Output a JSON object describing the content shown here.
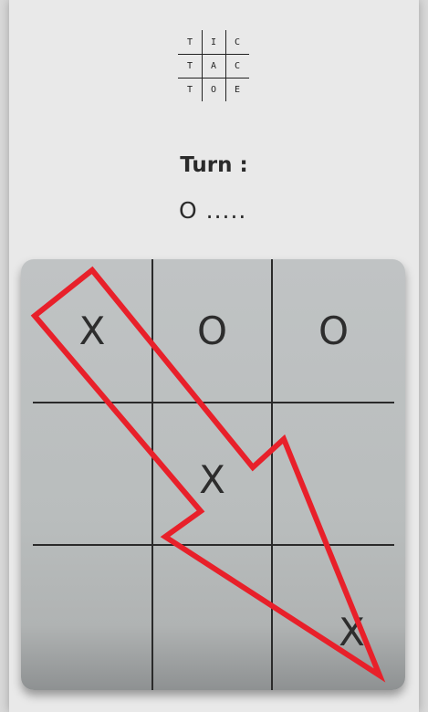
{
  "logo": {
    "letters": [
      [
        "T",
        "I",
        "C"
      ],
      [
        "T",
        "A",
        "C"
      ],
      [
        "T",
        "O",
        "E"
      ]
    ]
  },
  "turn": {
    "label": "Turn :",
    "value": "O ....."
  },
  "board": {
    "cells": [
      [
        "X",
        "O",
        "O"
      ],
      [
        "",
        "X",
        ""
      ],
      [
        "",
        "",
        "X"
      ]
    ]
  },
  "annotation": {
    "icon": "arrow-icon",
    "color": "#e8202a"
  }
}
